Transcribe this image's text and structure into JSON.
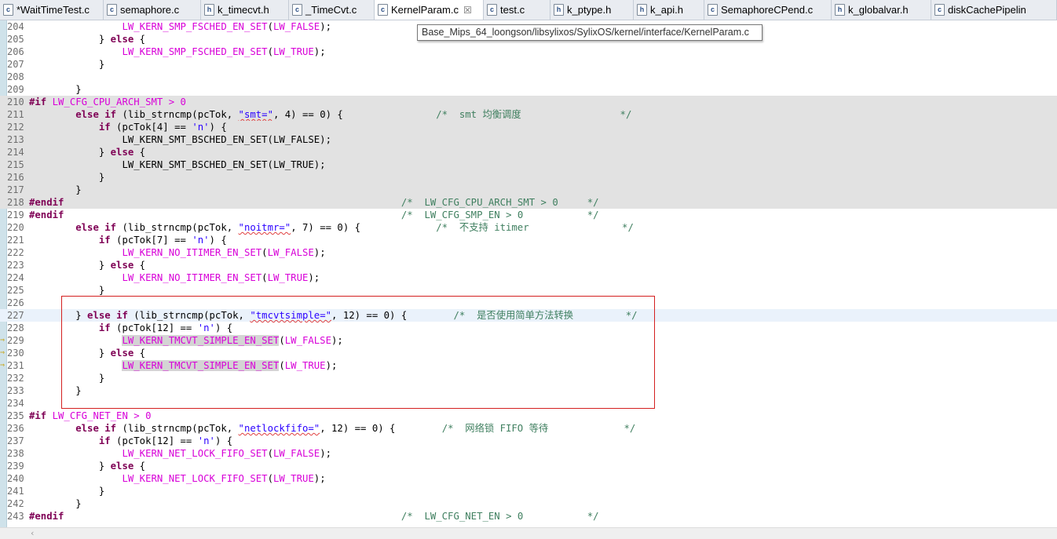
{
  "tabs": [
    {
      "label": "*WaitTimeTest.c",
      "icon": "c-file-icon",
      "glyph": "c",
      "w": 132
    },
    {
      "label": "semaphore.c",
      "icon": "c-file-icon",
      "glyph": "c",
      "w": 124
    },
    {
      "label": "k_timecvt.h",
      "icon": "h-file-icon",
      "glyph": "h",
      "w": 112
    },
    {
      "label": "_TimeCvt.c",
      "icon": "c-file-icon",
      "glyph": "c",
      "w": 109
    },
    {
      "label": "KernelParam.c",
      "icon": "c-file-icon",
      "glyph": "c",
      "w": 139,
      "active": true,
      "close": "☒"
    },
    {
      "label": "test.c",
      "icon": "c-file-icon",
      "glyph": "c",
      "w": 85
    },
    {
      "label": "k_ptype.h",
      "icon": "h-file-icon",
      "glyph": "h",
      "w": 106
    },
    {
      "label": "k_api.h",
      "icon": "h-file-icon",
      "glyph": "h",
      "w": 90
    },
    {
      "label": "SemaphoreCPend.c",
      "icon": "c-file-icon",
      "glyph": "c",
      "w": 162
    },
    {
      "label": "k_globalvar.h",
      "icon": "h-file-icon",
      "glyph": "h",
      "w": 127
    },
    {
      "label": "diskCachePipelin",
      "icon": "c-file-icon",
      "glyph": "c",
      "w": 160
    }
  ],
  "tooltip": "Base_Mips_64_loongson/libsylixos/SylixOS/kernel/interface/KernelParam.c",
  "lines": [
    {
      "n": "204",
      "t": [
        {
          "x": "                "
        },
        {
          "x": "LW_KERN_SMP_FSCHED_EN_SET",
          "c": "mac"
        },
        {
          "x": "("
        },
        {
          "x": "LW_FALSE",
          "c": "mac"
        },
        {
          "x": ");"
        }
      ]
    },
    {
      "n": "205",
      "t": [
        {
          "x": "            } "
        },
        {
          "x": "else",
          "c": "kw"
        },
        {
          "x": " {"
        }
      ]
    },
    {
      "n": "206",
      "t": [
        {
          "x": "                "
        },
        {
          "x": "LW_KERN_SMP_FSCHED_EN_SET",
          "c": "mac"
        },
        {
          "x": "("
        },
        {
          "x": "LW_TRUE",
          "c": "mac"
        },
        {
          "x": ");"
        }
      ]
    },
    {
      "n": "207",
      "t": [
        {
          "x": "            }"
        }
      ]
    },
    {
      "n": "208",
      "t": []
    },
    {
      "n": "209",
      "t": [
        {
          "x": "        }"
        }
      ]
    },
    {
      "n": "210",
      "bg": "shade",
      "t": [
        {
          "x": "#if",
          "c": "pp"
        },
        {
          "x": " "
        },
        {
          "x": "LW_CFG_CPU_ARCH_SMT > 0",
          "c": "mac"
        }
      ]
    },
    {
      "n": "211",
      "bg": "shade",
      "t": [
        {
          "x": "        "
        },
        {
          "x": "else if",
          "c": "kw"
        },
        {
          "x": " (lib_strncmp(pcTok, "
        },
        {
          "x": "\"smt=\"",
          "c": "str",
          "sq": true
        },
        {
          "x": ", 4) == 0) {                "
        },
        {
          "x": "/*  smt 均衡调度                 */",
          "c": "cmt"
        }
      ]
    },
    {
      "n": "212",
      "bg": "shade",
      "t": [
        {
          "x": "            "
        },
        {
          "x": "if",
          "c": "kw"
        },
        {
          "x": " (pcTok[4] == "
        },
        {
          "x": "'n'",
          "c": "chr"
        },
        {
          "x": ") {"
        }
      ]
    },
    {
      "n": "213",
      "bg": "shade",
      "t": [
        {
          "x": "                LW_KERN_SMT_BSCHED_EN_SET(LW_FALSE);"
        }
      ]
    },
    {
      "n": "214",
      "bg": "shade",
      "t": [
        {
          "x": "            } "
        },
        {
          "x": "else",
          "c": "kw"
        },
        {
          "x": " {"
        }
      ]
    },
    {
      "n": "215",
      "bg": "shade",
      "t": [
        {
          "x": "                LW_KERN_SMT_BSCHED_EN_SET(LW_TRUE);"
        }
      ]
    },
    {
      "n": "216",
      "bg": "shade",
      "t": [
        {
          "x": "            }"
        }
      ]
    },
    {
      "n": "217",
      "bg": "shade",
      "t": [
        {
          "x": "        }"
        }
      ]
    },
    {
      "n": "218",
      "bg": "shade",
      "t": [
        {
          "x": "#endif",
          "c": "pp"
        },
        {
          "x": "                                                          "
        },
        {
          "x": "/*  LW_CFG_CPU_ARCH_SMT > 0     */",
          "c": "cmt"
        }
      ]
    },
    {
      "n": "219",
      "t": [
        {
          "x": "#endif",
          "c": "pp"
        },
        {
          "x": "                                                          "
        },
        {
          "x": "/*  LW_CFG_SMP_EN > 0           */",
          "c": "cmt"
        }
      ]
    },
    {
      "n": "220",
      "t": [
        {
          "x": "        "
        },
        {
          "x": "else if",
          "c": "kw"
        },
        {
          "x": " (lib_strncmp(pcTok, "
        },
        {
          "x": "\"noitmr=\"",
          "c": "str",
          "sq": true
        },
        {
          "x": ", 7) == 0) {             "
        },
        {
          "x": "/*  不支持 itimer                */",
          "c": "cmt"
        }
      ]
    },
    {
      "n": "221",
      "t": [
        {
          "x": "            "
        },
        {
          "x": "if",
          "c": "kw"
        },
        {
          "x": " (pcTok[7] == "
        },
        {
          "x": "'n'",
          "c": "chr"
        },
        {
          "x": ") {"
        }
      ]
    },
    {
      "n": "222",
      "t": [
        {
          "x": "                "
        },
        {
          "x": "LW_KERN_NO_ITIMER_EN_SET",
          "c": "mac"
        },
        {
          "x": "("
        },
        {
          "x": "LW_FALSE",
          "c": "mac"
        },
        {
          "x": ");"
        }
      ]
    },
    {
      "n": "223",
      "t": [
        {
          "x": "            } "
        },
        {
          "x": "else",
          "c": "kw"
        },
        {
          "x": " {"
        }
      ]
    },
    {
      "n": "224",
      "t": [
        {
          "x": "                "
        },
        {
          "x": "LW_KERN_NO_ITIMER_EN_SET",
          "c": "mac"
        },
        {
          "x": "("
        },
        {
          "x": "LW_TRUE",
          "c": "mac"
        },
        {
          "x": ");"
        }
      ]
    },
    {
      "n": "225",
      "t": [
        {
          "x": "            }"
        }
      ]
    },
    {
      "n": "226",
      "t": []
    },
    {
      "n": "227",
      "bg": "cur",
      "t": [
        {
          "x": "        } "
        },
        {
          "x": "else if",
          "c": "kw"
        },
        {
          "x": " (lib_strncmp(pcTok, "
        },
        {
          "x": "\"tmcvtsimple=\"",
          "c": "str",
          "sq": true
        },
        {
          "x": ", 12) == 0) {        "
        },
        {
          "x": "/*  是否使用简单方法转换         */",
          "c": "cmt"
        }
      ]
    },
    {
      "n": "228",
      "t": [
        {
          "x": "            "
        },
        {
          "x": "if",
          "c": "kw"
        },
        {
          "x": " (pcTok[12] == "
        },
        {
          "x": "'n'",
          "c": "chr"
        },
        {
          "x": ") {"
        }
      ]
    },
    {
      "n": "229",
      "mark": true,
      "t": [
        {
          "x": "                "
        },
        {
          "x": "LW_KERN_TMCVT_SIMPLE_EN_SET",
          "c": "mac",
          "hl": true
        },
        {
          "x": "("
        },
        {
          "x": "LW_FALSE",
          "c": "mac"
        },
        {
          "x": ");"
        }
      ]
    },
    {
      "n": "230",
      "mark": true,
      "t": [
        {
          "x": "            } "
        },
        {
          "x": "else",
          "c": "kw"
        },
        {
          "x": " {"
        }
      ]
    },
    {
      "n": "231",
      "mark": true,
      "t": [
        {
          "x": "                "
        },
        {
          "x": "LW_KERN_TMCVT_SIMPLE_EN_SET",
          "c": "mac",
          "hl": true
        },
        {
          "x": "("
        },
        {
          "x": "LW_TRUE",
          "c": "mac"
        },
        {
          "x": ");"
        }
      ]
    },
    {
      "n": "232",
      "t": [
        {
          "x": "            }"
        }
      ]
    },
    {
      "n": "233",
      "t": [
        {
          "x": "        }"
        }
      ]
    },
    {
      "n": "234",
      "t": []
    },
    {
      "n": "235",
      "t": [
        {
          "x": "#if",
          "c": "pp"
        },
        {
          "x": " "
        },
        {
          "x": "LW_CFG_NET_EN > 0",
          "c": "mac"
        }
      ]
    },
    {
      "n": "236",
      "t": [
        {
          "x": "        "
        },
        {
          "x": "else if",
          "c": "kw"
        },
        {
          "x": " (lib_strncmp(pcTok, "
        },
        {
          "x": "\"netlockfifo=\"",
          "c": "str",
          "sq": true
        },
        {
          "x": ", 12) == 0) {        "
        },
        {
          "x": "/*  网络锁 FIFO 等待             */",
          "c": "cmt"
        }
      ]
    },
    {
      "n": "237",
      "t": [
        {
          "x": "            "
        },
        {
          "x": "if",
          "c": "kw"
        },
        {
          "x": " (pcTok[12] == "
        },
        {
          "x": "'n'",
          "c": "chr"
        },
        {
          "x": ") {"
        }
      ]
    },
    {
      "n": "238",
      "t": [
        {
          "x": "                "
        },
        {
          "x": "LW_KERN_NET_LOCK_FIFO_SET",
          "c": "mac"
        },
        {
          "x": "("
        },
        {
          "x": "LW_FALSE",
          "c": "mac"
        },
        {
          "x": ");"
        }
      ]
    },
    {
      "n": "239",
      "t": [
        {
          "x": "            } "
        },
        {
          "x": "else",
          "c": "kw"
        },
        {
          "x": " {"
        }
      ]
    },
    {
      "n": "240",
      "t": [
        {
          "x": "                "
        },
        {
          "x": "LW_KERN_NET_LOCK_FIFO_SET",
          "c": "mac"
        },
        {
          "x": "("
        },
        {
          "x": "LW_TRUE",
          "c": "mac"
        },
        {
          "x": ");"
        }
      ]
    },
    {
      "n": "241",
      "t": [
        {
          "x": "            }"
        }
      ]
    },
    {
      "n": "242",
      "t": [
        {
          "x": "        }"
        }
      ]
    },
    {
      "n": "243",
      "t": [
        {
          "x": "#endif",
          "c": "pp"
        },
        {
          "x": "                                                          "
        },
        {
          "x": "/*  LW_CFG_NET_EN > 0           */",
          "c": "cmt"
        }
      ]
    }
  ]
}
